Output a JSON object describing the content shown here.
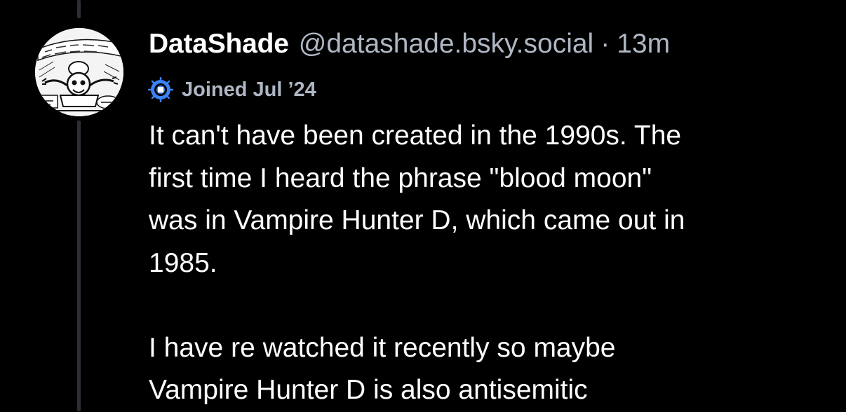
{
  "post": {
    "author": {
      "display_name": "DataShade",
      "handle": "@datashade.bsky.social",
      "avatar_icon": "cartoon-avatar"
    },
    "separator": "·",
    "time_ago": "13m",
    "joined": {
      "icon": "new-user-badge-icon",
      "label": "Joined Jul ’24"
    },
    "body": {
      "paragraph_1": "It can't have been created in the 1990s.  The\nfirst time I heard the phrase \"blood moon\"\nwas in Vampire Hunter D, which came out in\n1985.",
      "paragraph_2": "I have re watched it recently so maybe\nVampire Hunter D is also antisemitic"
    }
  },
  "colors": {
    "background": "#000000",
    "text_primary": "#ffffff",
    "text_secondary": "#aeb7c3",
    "thread_line": "#2b2f36",
    "badge_blue": "#3b82f6"
  }
}
